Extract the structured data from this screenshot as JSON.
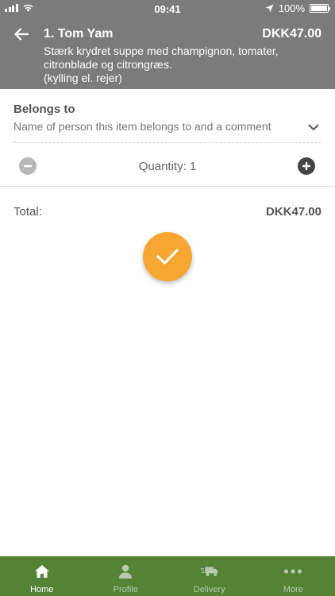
{
  "status_bar": {
    "time": "09:41",
    "battery": "100%",
    "signal_bars": 4
  },
  "header": {
    "title": "1. Tom Yam",
    "price": "DKK47.00",
    "description": "Stærk krydret suppe med champignon, tomater, citronblade og citrongræs.",
    "note": "(kylling el. rejer)"
  },
  "belongs_to": {
    "label": "Belongs to",
    "placeholder": "Name of person this item belongs to and a comment"
  },
  "quantity": {
    "text": "Quantity: 1"
  },
  "total": {
    "label": "Total:",
    "value": "DKK47.00"
  },
  "colors": {
    "header_bg": "#7b7b7b",
    "confirm_button": "#f6a631",
    "tab_bar_bg": "#548335",
    "tab_inactive": "#b9c9ae",
    "tab_active": "#ffffff"
  },
  "tabs": [
    {
      "label": "Home",
      "icon": "home-icon",
      "active": true
    },
    {
      "label": "Profile",
      "icon": "profile-icon",
      "active": false
    },
    {
      "label": "Delivery",
      "icon": "delivery-truck-icon",
      "active": false
    },
    {
      "label": "More",
      "icon": "more-dots-icon",
      "active": false
    }
  ]
}
